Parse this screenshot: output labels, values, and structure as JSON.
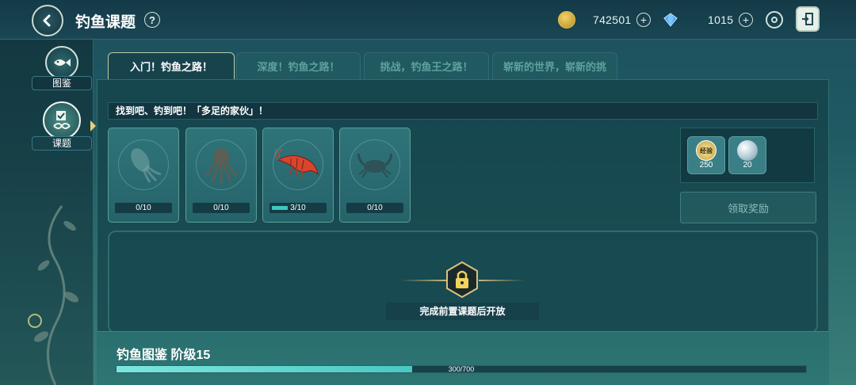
{
  "header": {
    "title": "钓鱼课题",
    "help_label": "?",
    "coins": "742501",
    "gems": "1015"
  },
  "sidebar": {
    "items": [
      {
        "label": "图鉴",
        "icon": "fish-book-icon"
      },
      {
        "label": "课题",
        "icon": "quest-scroll-icon",
        "active": true
      }
    ]
  },
  "tabs": [
    {
      "label": "入门！钓鱼之路！",
      "active": true
    },
    {
      "label": "深度！钓鱼之路！",
      "active": false
    },
    {
      "label": "挑战，钓鱼王之路！",
      "active": false
    },
    {
      "label": "崭新的世界，崭新的挑",
      "active": false
    }
  ],
  "quest": {
    "description": "找到吧、钓到吧！「多足的家伙」！",
    "targets": [
      {
        "creature": "squid",
        "progress_label": "0/10",
        "current": 0,
        "total": 10,
        "caught": false
      },
      {
        "creature": "octopus",
        "progress_label": "0/10",
        "current": 0,
        "total": 10,
        "caught": false
      },
      {
        "creature": "shrimp",
        "progress_label": "3/10",
        "current": 3,
        "total": 10,
        "caught": true
      },
      {
        "creature": "crab",
        "progress_label": "0/10",
        "current": 0,
        "total": 10,
        "caught": false
      }
    ],
    "rewards": [
      {
        "icon": "exp-badge-icon",
        "badge": "经验",
        "count": "250"
      },
      {
        "icon": "pearl-icon",
        "count": "20"
      }
    ],
    "claim_label": "领取奖励"
  },
  "locked": {
    "message": "完成前置课题后开放"
  },
  "dex": {
    "title": "钓鱼图鉴  阶级15",
    "progress_label": "300/700",
    "current": 300,
    "total": 700
  },
  "colors": {
    "accent": "#3fc7c0",
    "tab_border": "#b6cfa6",
    "shrimp": "#d8452e"
  }
}
